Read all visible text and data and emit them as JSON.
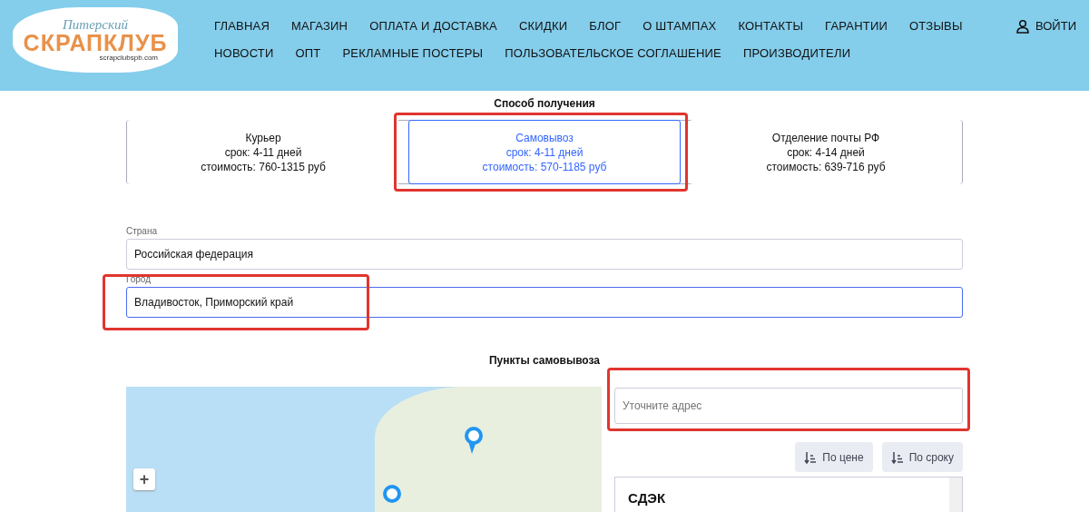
{
  "header": {
    "logo": {
      "script": "Питерский",
      "title": "СКРАПКЛУБ",
      "site": "scrapclubspb.com"
    },
    "nav_rows": [
      [
        "ГЛАВНАЯ",
        "МАГАЗИН",
        "ОПЛАТА И ДОСТАВКА",
        "СКИДКИ",
        "БЛОГ",
        "О ШТАМПАХ",
        "КОНТАКТЫ",
        "ГАРАНТИИ",
        "ОТЗЫВЫ"
      ],
      [
        "НОВОСТИ",
        "ОПТ",
        "РЕКЛАМНЫЕ ПОСТЕРЫ",
        "ПОЛЬЗОВАТЕЛЬСКОЕ СОГЛАШЕНИЕ",
        "ПРОИЗВОДИТЕЛИ"
      ]
    ],
    "login": "ВОЙТИ"
  },
  "delivery": {
    "title": "Способ получения",
    "options": [
      {
        "name": "Курьер",
        "term": "срок: 4-11 дней",
        "cost": "стоимость: 760-1315 руб",
        "selected": false,
        "highlighted": false
      },
      {
        "name": "Самовывоз",
        "term": "срок: 4-11 дней",
        "cost": "стоимость: 570-1185 руб",
        "selected": true,
        "highlighted": true
      },
      {
        "name": "Отделение почты РФ",
        "term": "срок: 4-14 дней",
        "cost": "стоимость: 639-716 руб",
        "selected": false,
        "highlighted": false
      }
    ]
  },
  "fields": [
    {
      "label": "Страна",
      "value": "Российская федерация",
      "focused": false,
      "highlighted": false
    },
    {
      "label": "Город",
      "value": "Владивосток, Приморский край",
      "focused": true,
      "highlighted": true
    }
  ],
  "pickup": {
    "title": "Пункты самовывоза",
    "map": {
      "zoom_in": "+"
    },
    "address": {
      "placeholder": "Уточните адрес",
      "highlighted": true
    },
    "sort_buttons": [
      "По цене",
      "По сроку"
    ],
    "points": [
      {
        "name": "СДЭК"
      }
    ]
  }
}
